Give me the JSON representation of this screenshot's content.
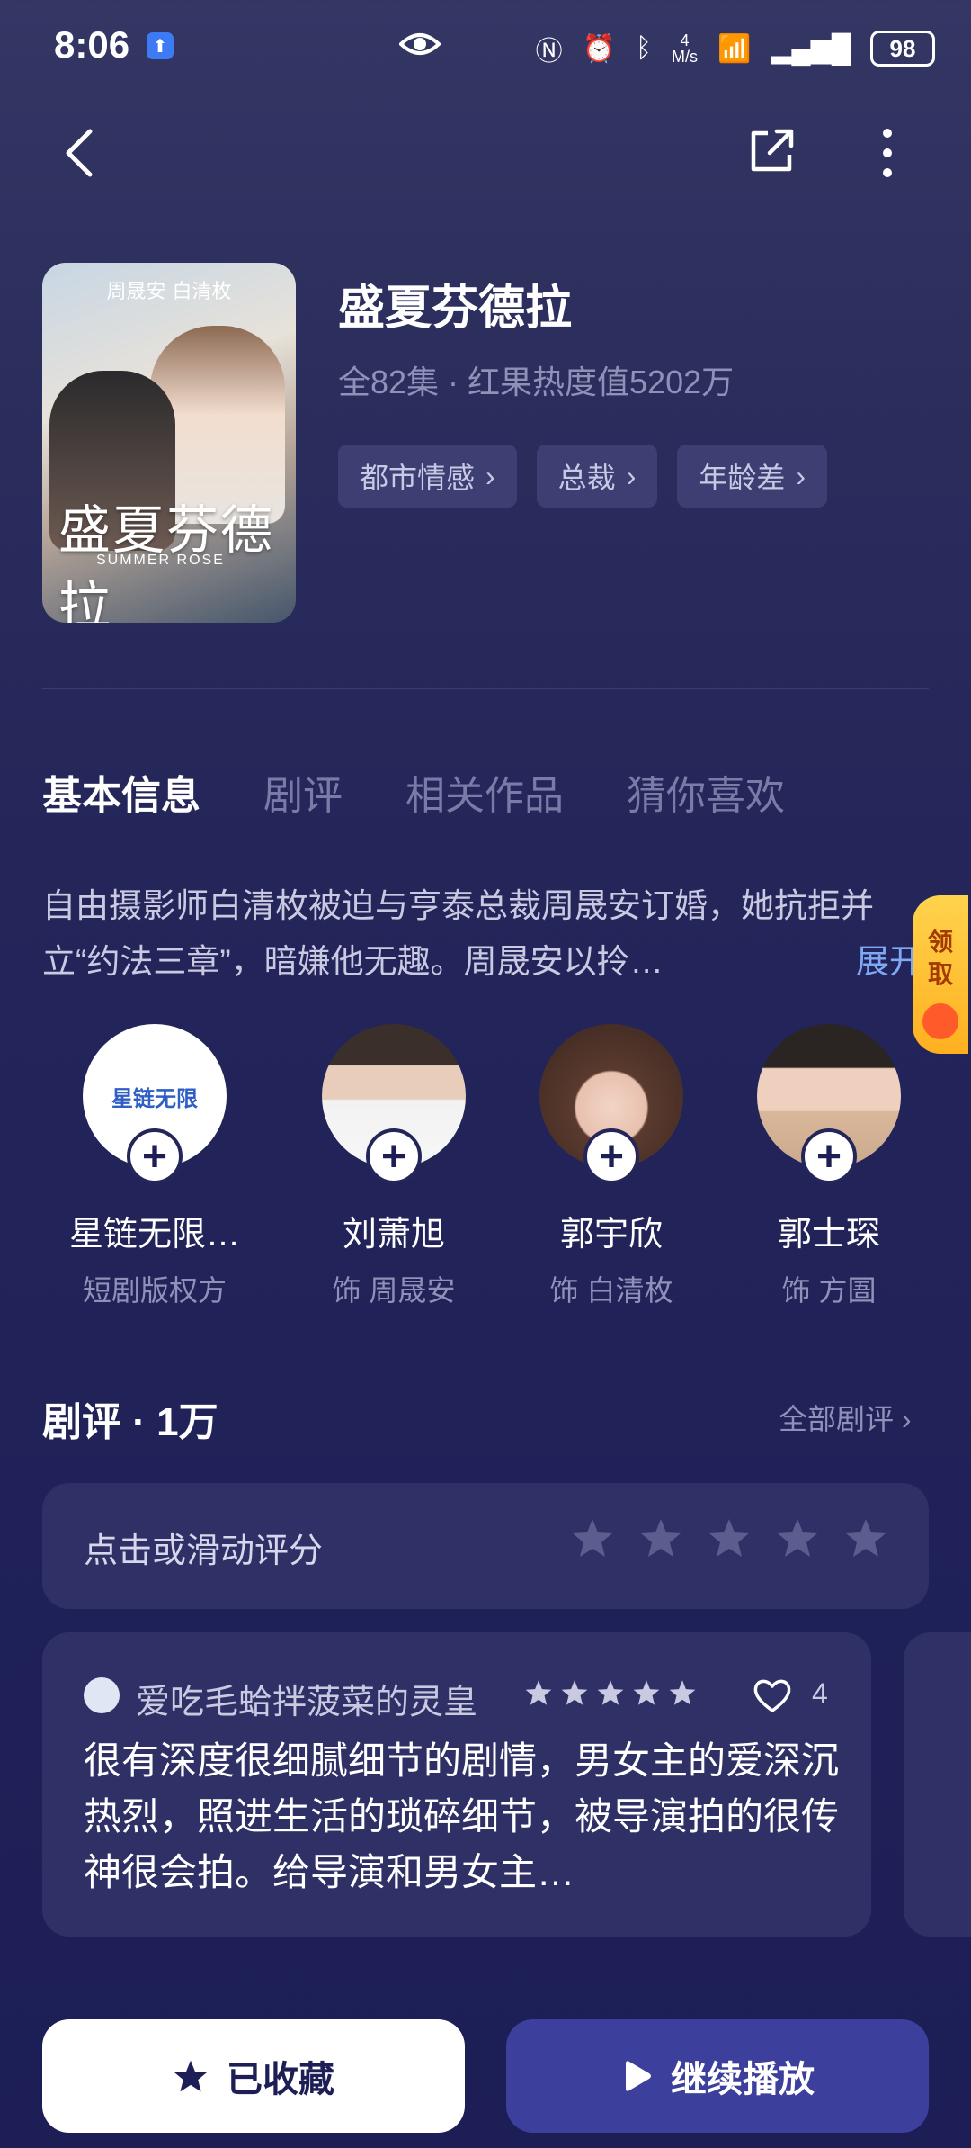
{
  "status_bar": {
    "time": "8:06",
    "net_speed_top": "4",
    "net_speed_unit": "M/s",
    "signal_label": "6",
    "battery": "98"
  },
  "drama": {
    "title": "盛夏芬德拉",
    "meta": "全82集 · 红果热度值5202万",
    "tags": [
      "都市情感",
      "总裁",
      "年龄差"
    ],
    "poster": {
      "top_text": "周晟安 白清枚",
      "logo_text": "盛夏芬德拉",
      "subtitle": "SUMMER ROSE"
    }
  },
  "tabs": [
    "基本信息",
    "剧评",
    "相关作品",
    "猜你喜欢"
  ],
  "synopsis": {
    "text": "自由摄影师白清枚被迫与亨泰总裁周晟安订婚，她抗拒并立“约法三章”，暗嫌他无趣。周晟安以拎…",
    "expand": "展开"
  },
  "claim_badge": "领取",
  "cast": [
    {
      "name": "星链无限…",
      "role": "短剧版权方",
      "logo": "星链无限"
    },
    {
      "name": "刘萧旭",
      "role": "饰 周晟安"
    },
    {
      "name": "郭宇欣",
      "role": "饰 白清枚"
    },
    {
      "name": "郭士琛",
      "role": "饰 方圄"
    }
  ],
  "reviews": {
    "title": "剧评 · 1万",
    "all_label": "全部剧评",
    "rate_prompt": "点击或滑动评分",
    "card": {
      "user": "爱吃毛蛤拌菠菜的灵皇",
      "stars": 5,
      "likes": "4",
      "text": "很有深度很细腻细节的剧情，男女主的爱深沉热烈，照进生活的琐碎细节，被导演拍的很传神很会拍。给导演和男女主…"
    }
  },
  "buttons": {
    "favorite": "已收藏",
    "play": "继续播放"
  },
  "colors": {
    "background": "#24265a",
    "card": "#2f3166",
    "accent": "#3c3f9c",
    "link": "#7fa8f5"
  }
}
